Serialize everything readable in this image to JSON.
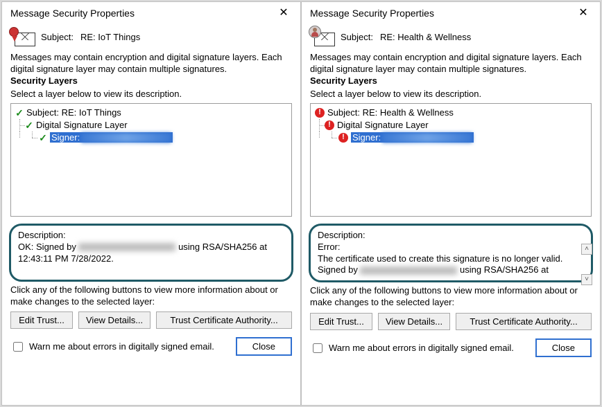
{
  "dialogs": [
    {
      "title": "Message Security Properties",
      "subject_label": "Subject:",
      "subject_value": "RE: IoT Things",
      "icon_type": "ribbon",
      "intro": "Messages may contain encryption and digital signature layers. Each digital signature layer may contain multiple signatures.",
      "layers_heading": "Security Layers",
      "layers_hint": "Select a layer below to view its description.",
      "tree": {
        "status": "ok",
        "row1": "Subject: RE: IoT Things",
        "row2": "Digital Signature Layer",
        "row3": "Signer:"
      },
      "desc_label": "Description:",
      "desc_lines": [
        "OK: Signed by ",
        " using RSA/SHA256 at",
        "12:43:11 PM 7/28/2022."
      ],
      "has_scroll": false,
      "note": "Click any of the following buttons to view more information about or make changes to the selected layer:",
      "buttons": {
        "edit": "Edit Trust...",
        "view": "View Details...",
        "trust": "Trust Certificate Authority..."
      },
      "warn_label": "Warn me about errors in digitally signed email.",
      "close_label": "Close"
    },
    {
      "title": "Message Security Properties",
      "subject_label": "Subject:",
      "subject_value": "RE: Health & Wellness",
      "icon_type": "person",
      "intro": "Messages may contain encryption and digital signature layers. Each digital signature layer may contain multiple signatures.",
      "layers_heading": "Security Layers",
      "layers_hint": "Select a layer below to view its description.",
      "tree": {
        "status": "error",
        "row1": "Subject: RE: Health & Wellness",
        "row2": "Digital Signature Layer",
        "row3": "Signer:"
      },
      "desc_label": "Description:",
      "desc_lines": [
        "Error:",
        "The certificate used to create this signature is no longer valid.",
        "Signed by ",
        " using RSA/SHA256 at"
      ],
      "has_scroll": true,
      "note": "Click any of the following buttons to view more information about or make changes to the selected layer:",
      "buttons": {
        "edit": "Edit Trust...",
        "view": "View Details...",
        "trust": "Trust Certificate Authority..."
      },
      "warn_label": "Warn me about errors in digitally signed email.",
      "close_label": "Close"
    }
  ]
}
